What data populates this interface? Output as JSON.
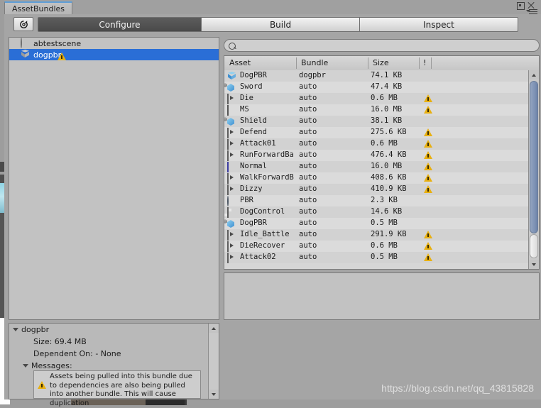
{
  "window": {
    "tab_label": "AssetBundles",
    "controls": {
      "maximize": "maximize-icon",
      "close": "close-icon",
      "menu": "options-menu-icon"
    }
  },
  "toolbar": {
    "refresh_icon": "refresh-icon",
    "segments": [
      {
        "label": "Configure",
        "active": true
      },
      {
        "label": "Build",
        "active": false
      },
      {
        "label": "Inspect",
        "active": false
      }
    ]
  },
  "bundle_tree": {
    "items": [
      {
        "label": "abtestscene",
        "icon": "scene-icon",
        "selected": false,
        "warning": false
      },
      {
        "label": "dogpbr",
        "icon": "bundle-cube-icon",
        "selected": true,
        "warning": true
      }
    ]
  },
  "search": {
    "value": "",
    "placeholder": "",
    "icon": "search-icon"
  },
  "asset_list": {
    "columns": [
      "Asset",
      "Bundle",
      "Size",
      "!"
    ],
    "rows": [
      {
        "asset": "DogPBR",
        "bundle": "dogpbr",
        "size": "74.1 KB",
        "warning": false,
        "icon": "prefab-icon"
      },
      {
        "asset": "Sword",
        "bundle": "auto",
        "size": "47.4 KB",
        "warning": false,
        "icon": "model-icon"
      },
      {
        "asset": "Die",
        "bundle": "auto",
        "size": "0.6 MB",
        "warning": true,
        "icon": "animation-icon"
      },
      {
        "asset": "MS",
        "bundle": "auto",
        "size": "16.0 MB",
        "warning": true,
        "icon": "texture-icon"
      },
      {
        "asset": "Shield",
        "bundle": "auto",
        "size": "38.1 KB",
        "warning": false,
        "icon": "model-icon"
      },
      {
        "asset": "Defend",
        "bundle": "auto",
        "size": "275.6 KB",
        "warning": true,
        "icon": "animation-icon"
      },
      {
        "asset": "Attack01",
        "bundle": "auto",
        "size": "0.6 MB",
        "warning": true,
        "icon": "animation-icon"
      },
      {
        "asset": "RunForwardBa",
        "bundle": "auto",
        "size": "476.4 KB",
        "warning": true,
        "icon": "animation-icon"
      },
      {
        "asset": "Normal",
        "bundle": "auto",
        "size": "16.0 MB",
        "warning": true,
        "icon": "normalmap-icon"
      },
      {
        "asset": "WalkForwardB",
        "bundle": "auto",
        "size": "408.6 KB",
        "warning": true,
        "icon": "animation-icon"
      },
      {
        "asset": "Dizzy",
        "bundle": "auto",
        "size": "410.9 KB",
        "warning": true,
        "icon": "animation-icon"
      },
      {
        "asset": "PBR",
        "bundle": "auto",
        "size": "2.3 KB",
        "warning": false,
        "icon": "material-icon"
      },
      {
        "asset": "DogControl",
        "bundle": "auto",
        "size": "14.6 KB",
        "warning": false,
        "icon": "animator-controller-icon"
      },
      {
        "asset": "DogPBR",
        "bundle": "auto",
        "size": "0.5 MB",
        "warning": false,
        "icon": "model-icon"
      },
      {
        "asset": "Idle_Battle",
        "bundle": "auto",
        "size": "291.9 KB",
        "warning": true,
        "icon": "animation-icon"
      },
      {
        "asset": "DieRecover",
        "bundle": "auto",
        "size": "0.6 MB",
        "warning": true,
        "icon": "animation-icon"
      },
      {
        "asset": "Attack02",
        "bundle": "auto",
        "size": "0.5 MB",
        "warning": true,
        "icon": "animation-icon"
      }
    ]
  },
  "detail": {
    "title": "dogpbr",
    "size_label": "Size: 69.4 MB",
    "dependent_label": "Dependent On: - None",
    "messages_label": "Messages:",
    "message_text": "Assets being pulled into this bundle due to dependencies are also being pulled into another bundle.  This will cause duplication",
    "message_icon": "warning-icon"
  },
  "watermark": "https://blog.csdn.net/qq_43815828",
  "colors": {
    "selection": "#2a6ed6",
    "warning": "#e8b011",
    "panel": "#a5a5a5",
    "list_row_odd": "#d2d2d2",
    "list_row_even": "#dbdbdb",
    "scroll_thumb": "#7e93b5"
  }
}
